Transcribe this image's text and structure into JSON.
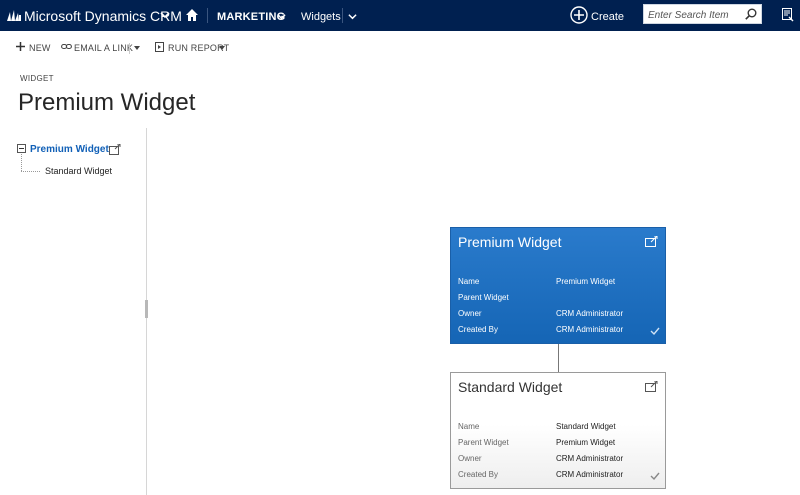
{
  "topnav": {
    "app_name": "Microsoft Dynamics CRM",
    "area": "MARKETING",
    "subarea": "Widgets",
    "create_label": "Create",
    "search_placeholder": "Enter Search Item"
  },
  "commandbar": {
    "new_label": "NEW",
    "email_link_label": "EMAIL A LINK",
    "run_report_label": "RUN REPORT"
  },
  "header": {
    "entity_label": "WIDGET",
    "record_title": "Premium Widget"
  },
  "tree": {
    "root_label": "Premium Widget",
    "child_label": "Standard Widget"
  },
  "cards": [
    {
      "title": "Premium Widget",
      "selected": true,
      "fields": [
        {
          "label": "Name",
          "value": "Premium Widget"
        },
        {
          "label": "Parent Widget",
          "value": ""
        },
        {
          "label": "Owner",
          "value": "CRM Administrator"
        },
        {
          "label": "Created By",
          "value": "CRM Administrator"
        }
      ]
    },
    {
      "title": "Standard Widget",
      "selected": false,
      "fields": [
        {
          "label": "Name",
          "value": "Standard Widget"
        },
        {
          "label": "Parent Widget",
          "value": "Premium Widget"
        },
        {
          "label": "Owner",
          "value": "CRM Administrator"
        },
        {
          "label": "Created By",
          "value": "CRM Administrator"
        }
      ]
    }
  ],
  "colors": {
    "nav_bg": "#002050",
    "card_selected": "#1e6fc0",
    "link_blue": "#1160b7"
  }
}
